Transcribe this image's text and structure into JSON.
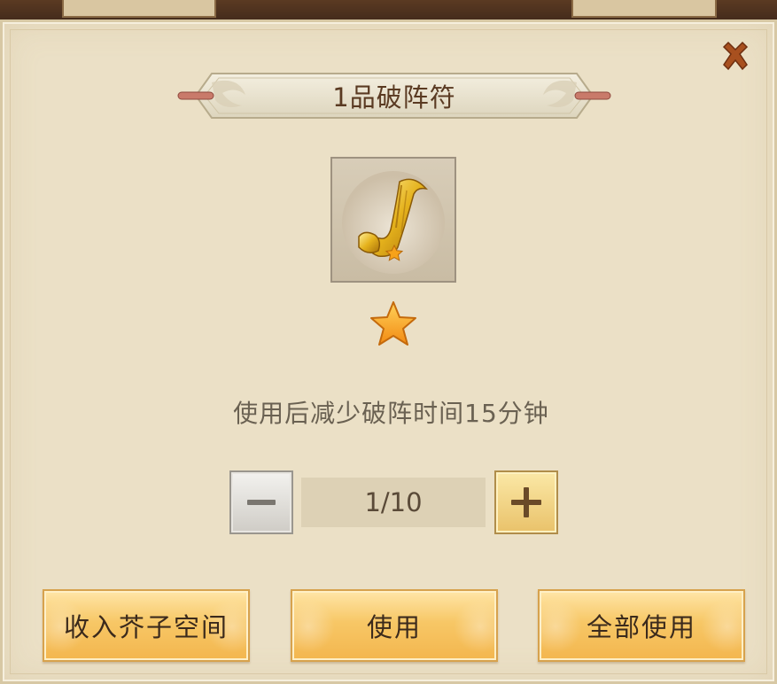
{
  "dialog": {
    "title": "1品破阵符",
    "description": "使用后减少破阵时间15分钟",
    "stars": 1
  },
  "quantity": {
    "display": "1/10"
  },
  "buttons": {
    "store": "收入芥子空间",
    "use": "使用",
    "use_all": "全部使用"
  },
  "icons": {
    "close": "close-icon",
    "minus": "minus-icon",
    "plus": "plus-icon",
    "item": "golden-scroll-icon",
    "star": "star-icon"
  },
  "colors": {
    "panel_bg": "#ebe0c6",
    "button_gold": "#f7c766",
    "close_brown": "#a04a1e",
    "title_text": "#5a3a22"
  }
}
